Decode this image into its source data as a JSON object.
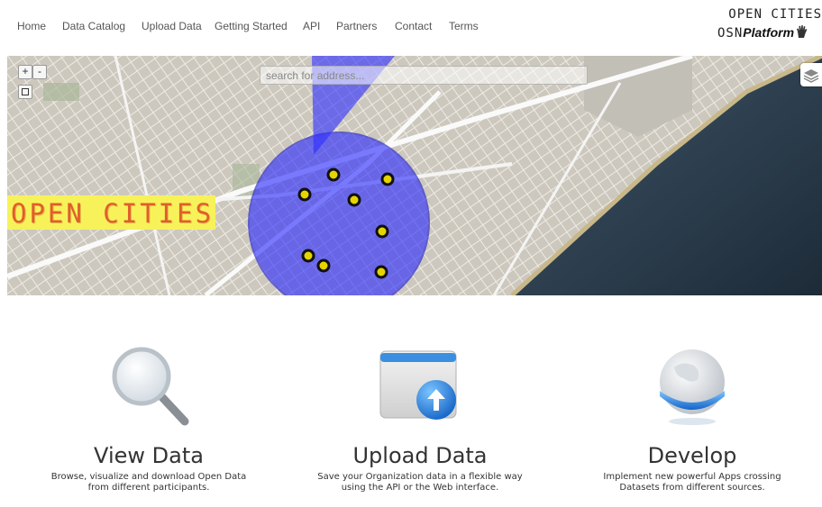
{
  "nav": {
    "items": [
      "Home",
      "Data Catalog",
      "Upload Data",
      "Getting Started",
      "API",
      "Partners",
      "Contact",
      "Terms"
    ]
  },
  "logo": {
    "line1": "OPEN CITIES",
    "osn": "OSN",
    "platform": "Platform",
    "icon": "hand-icon"
  },
  "map": {
    "zoom_in": "+",
    "zoom_out": "-",
    "search_placeholder": "search for address...",
    "banner": "OPEN CITIES",
    "layers_icon": "layers-icon",
    "circle_color": "#2b2bff",
    "marker_color": "#e6d400"
  },
  "features": [
    {
      "icon": "magnifier-icon",
      "title": "View Data",
      "desc": "Browse, visualize and download Open Data from different participants."
    },
    {
      "icon": "upload-icon",
      "title": "Upload Data",
      "desc": "Save your Organization data in a flexible way using the API or the Web interface."
    },
    {
      "icon": "globe-icon",
      "title": "Develop",
      "desc": "Implement new powerful Apps crossing Datasets from different sources."
    }
  ]
}
